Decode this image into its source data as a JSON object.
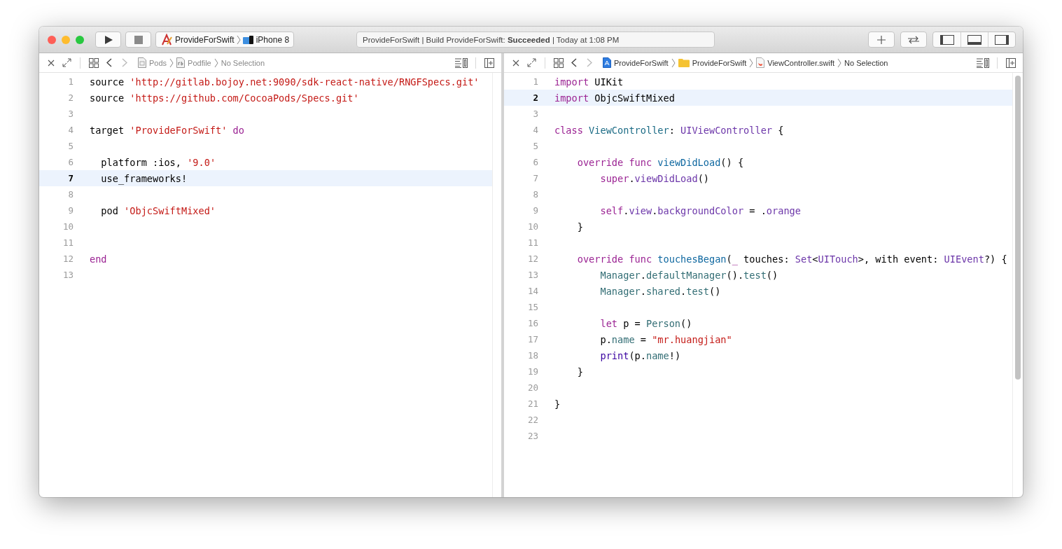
{
  "toolbar": {
    "scheme": {
      "target": "ProvideForSwift",
      "device": "iPhone 8"
    },
    "activity": "ProvideForSwift | Build ProvideForSwift: **Succeeded** | Today at 1:08 PM"
  },
  "editors": [
    {
      "back": {
        "disabled": false
      },
      "forward": {
        "disabled": true
      },
      "breadcrumbs": [
        {
          "kind": "group",
          "label": "Pods"
        },
        {
          "kind": "ruby-file",
          "label": "Podfile"
        },
        {
          "kind": "none",
          "label": "No Selection"
        }
      ],
      "lines": [
        {
          "number": "1",
          "current": false,
          "tokens": [
            {
              "kind": "plain",
              "text": "source "
            },
            {
              "kind": "string",
              "text": "'http://gitlab.bojoy.net:9090/sdk-react-native/RNGFSpecs.git'"
            }
          ]
        },
        {
          "number": "2",
          "current": false,
          "tokens": [
            {
              "kind": "plain",
              "text": "source "
            },
            {
              "kind": "string",
              "text": "'https://github.com/CocoaPods/Specs.git'"
            }
          ]
        },
        {
          "number": "3",
          "current": false
        },
        {
          "number": "4",
          "current": false,
          "tokens": [
            {
              "kind": "plain",
              "text": "target "
            },
            {
              "kind": "string",
              "text": "'ProvideForSwift'"
            },
            {
              "kind": "keyword",
              "text": " do"
            }
          ]
        },
        {
          "number": "5",
          "current": false
        },
        {
          "number": "6",
          "current": false,
          "tokens": [
            {
              "kind": "plain",
              "text": "  platform :ios, "
            },
            {
              "kind": "string",
              "text": "'9.0'"
            }
          ]
        },
        {
          "number": "7",
          "current": true,
          "tokens": [
            {
              "kind": "plain",
              "text": "  use_frameworks!"
            }
          ]
        },
        {
          "number": "8",
          "current": false
        },
        {
          "number": "9",
          "current": false,
          "tokens": [
            {
              "kind": "plain",
              "text": "  pod "
            },
            {
              "kind": "string",
              "text": "'ObjcSwiftMixed'"
            }
          ]
        },
        {
          "number": "10",
          "current": false
        },
        {
          "number": "11",
          "current": false
        },
        {
          "number": "12",
          "current": false,
          "tokens": [
            {
              "kind": "keyword",
              "text": "end"
            }
          ]
        },
        {
          "number": "13",
          "current": false
        }
      ]
    },
    {
      "back": {
        "disabled": false
      },
      "forward": {
        "disabled": true
      },
      "breadcrumbs": [
        {
          "kind": "project",
          "label": "ProvideForSwift"
        },
        {
          "kind": "folder",
          "label": "ProvideForSwift"
        },
        {
          "kind": "swift-file",
          "label": "ViewController.swift"
        },
        {
          "kind": "none",
          "label": "No Selection"
        }
      ],
      "lines": [
        {
          "number": "1",
          "current": false,
          "tokens": [
            {
              "kind": "keyword",
              "text": "import"
            },
            {
              "kind": "plain",
              "text": " UIKit"
            }
          ]
        },
        {
          "number": "2",
          "current": true,
          "tokens": [
            {
              "kind": "keyword",
              "text": "import"
            },
            {
              "kind": "plain",
              "text": " ObjcSwiftMixed"
            }
          ]
        },
        {
          "number": "3",
          "current": false
        },
        {
          "number": "4",
          "current": false,
          "tokens": [
            {
              "kind": "keyword",
              "text": "class"
            },
            {
              "kind": "decl-type",
              "text": " ViewController"
            },
            {
              "kind": "plain",
              "text": ": "
            },
            {
              "kind": "sys-type",
              "text": "UIViewController"
            },
            {
              "kind": "plain",
              "text": " {"
            }
          ]
        },
        {
          "number": "5",
          "current": false
        },
        {
          "number": "6",
          "current": false,
          "tokens": [
            {
              "kind": "keyword",
              "text": "    override func"
            },
            {
              "kind": "decl-func",
              "text": " viewDidLoad"
            },
            {
              "kind": "plain",
              "text": "() {"
            }
          ]
        },
        {
          "number": "7",
          "current": false,
          "tokens": [
            {
              "kind": "keyword",
              "text": "        super"
            },
            {
              "kind": "plain",
              "text": "."
            },
            {
              "kind": "sys-type",
              "text": "viewDidLoad"
            },
            {
              "kind": "plain",
              "text": "()"
            }
          ]
        },
        {
          "number": "8",
          "current": false
        },
        {
          "number": "9",
          "current": false,
          "tokens": [
            {
              "kind": "keyword",
              "text": "        self"
            },
            {
              "kind": "plain",
              "text": "."
            },
            {
              "kind": "sys-type",
              "text": "view"
            },
            {
              "kind": "plain",
              "text": "."
            },
            {
              "kind": "sys-type",
              "text": "backgroundColor"
            },
            {
              "kind": "plain",
              "text": " = ."
            },
            {
              "kind": "sys-type",
              "text": "orange"
            }
          ]
        },
        {
          "number": "10",
          "current": false,
          "tokens": [
            {
              "kind": "plain",
              "text": "    }"
            }
          ]
        },
        {
          "number": "11",
          "current": false
        },
        {
          "number": "12",
          "current": false,
          "tokens": [
            {
              "kind": "keyword",
              "text": "    override func"
            },
            {
              "kind": "decl-func",
              "text": " touchesBegan"
            },
            {
              "kind": "plain",
              "text": "("
            },
            {
              "kind": "keyword",
              "text": "_"
            },
            {
              "kind": "plain",
              "text": " touches: "
            },
            {
              "kind": "sys-type",
              "text": "Set"
            },
            {
              "kind": "plain",
              "text": "<"
            },
            {
              "kind": "sys-type",
              "text": "UITouch"
            },
            {
              "kind": "plain",
              "text": ">, with event: "
            },
            {
              "kind": "sys-type",
              "text": "UIEvent"
            },
            {
              "kind": "plain",
              "text": "?) {"
            }
          ]
        },
        {
          "number": "13",
          "current": false,
          "tokens": [
            {
              "kind": "project",
              "text": "        Manager"
            },
            {
              "kind": "plain",
              "text": "."
            },
            {
              "kind": "project",
              "text": "defaultManager"
            },
            {
              "kind": "plain",
              "text": "()."
            },
            {
              "kind": "project",
              "text": "test"
            },
            {
              "kind": "plain",
              "text": "()"
            }
          ]
        },
        {
          "number": "14",
          "current": false,
          "tokens": [
            {
              "kind": "project",
              "text": "        Manager"
            },
            {
              "kind": "plain",
              "text": "."
            },
            {
              "kind": "project",
              "text": "shared"
            },
            {
              "kind": "plain",
              "text": "."
            },
            {
              "kind": "project",
              "text": "test"
            },
            {
              "kind": "plain",
              "text": "()"
            }
          ]
        },
        {
          "number": "15",
          "current": false
        },
        {
          "number": "16",
          "current": false,
          "tokens": [
            {
              "kind": "keyword",
              "text": "        let"
            },
            {
              "kind": "plain",
              "text": " p = "
            },
            {
              "kind": "project",
              "text": "Person"
            },
            {
              "kind": "plain",
              "text": "()"
            }
          ]
        },
        {
          "number": "17",
          "current": false,
          "tokens": [
            {
              "kind": "plain",
              "text": "        p."
            },
            {
              "kind": "project",
              "text": "name"
            },
            {
              "kind": "plain",
              "text": " = "
            },
            {
              "kind": "string",
              "text": "\"mr.huangjian\""
            }
          ]
        },
        {
          "number": "18",
          "current": false,
          "tokens": [
            {
              "kind": "sys-func",
              "text": "        print"
            },
            {
              "kind": "plain",
              "text": "(p."
            },
            {
              "kind": "project",
              "text": "name"
            },
            {
              "kind": "plain",
              "text": "!)"
            }
          ]
        },
        {
          "number": "19",
          "current": false,
          "tokens": [
            {
              "kind": "plain",
              "text": "    }"
            }
          ]
        },
        {
          "number": "20",
          "current": false
        },
        {
          "number": "21",
          "current": false,
          "tokens": [
            {
              "kind": "plain",
              "text": "}"
            }
          ]
        },
        {
          "number": "22",
          "current": false
        },
        {
          "number": "23",
          "current": false
        }
      ]
    }
  ]
}
